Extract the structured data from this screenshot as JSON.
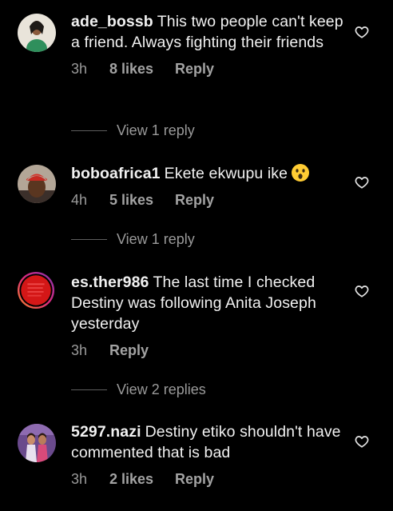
{
  "comments": [
    {
      "username": "ade_bossb",
      "text": "This two people can't keep a friend. Always fighting their friends",
      "time": "3h",
      "likes": "8 likes",
      "reply_label": "Reply",
      "view_replies": "View 1 reply"
    },
    {
      "username": "boboafrica1",
      "text": "Ekete ekwupu ike",
      "emoji": "astonished-face-emoji",
      "time": "4h",
      "likes": "5 likes",
      "reply_label": "Reply",
      "view_replies": "View 1 reply"
    },
    {
      "username": "es.ther986",
      "text": "The last time I checked Destiny was following Anita Joseph yesterday",
      "time": "3h",
      "likes": "",
      "reply_label": "Reply",
      "view_replies": "View 2 replies"
    },
    {
      "username": "5297.nazi",
      "text": "Destiny etiko shouldn't have commented that  is bad",
      "time": "3h",
      "likes": "2 likes",
      "reply_label": "Reply"
    }
  ],
  "colors": {
    "background": "#000000",
    "text": "#f1f1f1",
    "meta": "#9a9a9a",
    "story_ring": "#c13584"
  },
  "icons": {
    "like": "heart-outline-icon"
  }
}
